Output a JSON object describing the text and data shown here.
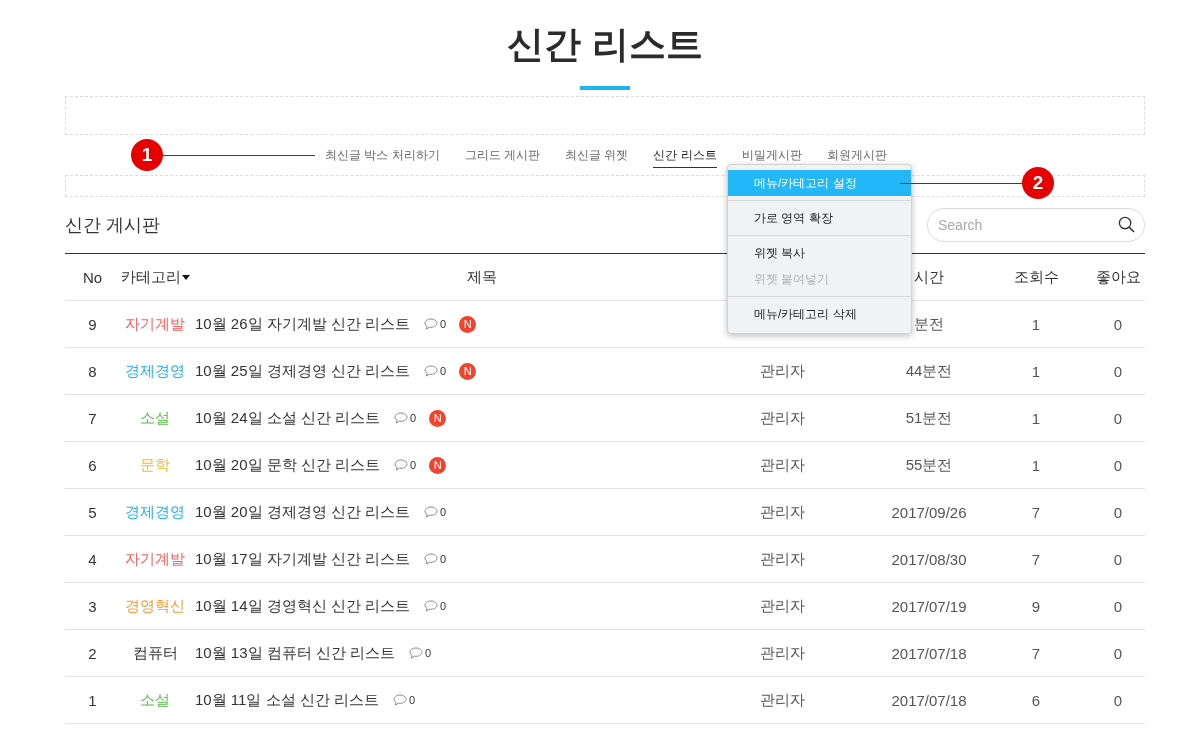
{
  "page_title": "신간 리스트",
  "nav": {
    "items": [
      {
        "label": "최신글 박스 처리하기",
        "selected": false
      },
      {
        "label": "그리드 게시판",
        "selected": false
      },
      {
        "label": "최신글 위젯",
        "selected": false
      },
      {
        "label": "신간 리스트",
        "selected": true
      },
      {
        "label": "비밀게시판",
        "selected": false
      },
      {
        "label": "회원게시판",
        "selected": false
      }
    ]
  },
  "callouts": [
    {
      "label": "1"
    },
    {
      "label": "2"
    }
  ],
  "context_menu": {
    "groups": [
      [
        {
          "label": "메뉴/카테고리 설정",
          "selected": true,
          "disabled": false
        }
      ],
      [
        {
          "label": "가로 영역 확장",
          "selected": false,
          "disabled": false
        }
      ],
      [
        {
          "label": "위젯 복사",
          "selected": false,
          "disabled": false
        },
        {
          "label": "위젯 붙여넣기",
          "selected": false,
          "disabled": true
        }
      ],
      [
        {
          "label": "메뉴/카테고리 삭제",
          "selected": false,
          "disabled": false
        }
      ]
    ]
  },
  "board": {
    "title": "신간 게시판",
    "search": {
      "placeholder": "Search"
    }
  },
  "table": {
    "header": {
      "no": "No",
      "category": "카테고리",
      "title": "제목",
      "time": "시간",
      "views": "조회수",
      "likes": "좋아요"
    },
    "rows": [
      {
        "no": "9",
        "category": {
          "label": "자기계발",
          "color": "#ff5c5c"
        },
        "title": "10월 26일 자기계발 신간 리스트",
        "comments": "0",
        "badge": "N",
        "time": "분전",
        "views": "1",
        "likes": "0"
      },
      {
        "no": "8",
        "category": {
          "label": "경제경영",
          "color": "#1fb2f0"
        },
        "title": "10월 25일 경제경영 신간 리스트",
        "comments": "0",
        "badge": "N",
        "writer": "관리자",
        "time": "44분전",
        "views": "1",
        "likes": "0"
      },
      {
        "no": "7",
        "category": {
          "label": "소설",
          "color": "#5cbf4a"
        },
        "title": "10월 24일 소설 신간 리스트",
        "comments": "0",
        "badge": "N",
        "writer": "관리자",
        "time": "51분전",
        "views": "1",
        "likes": "0"
      },
      {
        "no": "6",
        "category": {
          "label": "문학",
          "color": "#f2b736"
        },
        "title": "10월 20일 문학 신간 리스트",
        "comments": "0",
        "badge": "N",
        "writer": "관리자",
        "time": "55분전",
        "views": "1",
        "likes": "0"
      },
      {
        "no": "5",
        "category": {
          "label": "경제경영",
          "color": "#1fb2f0"
        },
        "title": "10월 20일 경제경영 신간 리스트",
        "comments": "0",
        "writer": "관리자",
        "time": "2017/09/26",
        "views": "7",
        "likes": "0"
      },
      {
        "no": "4",
        "category": {
          "label": "자기계발",
          "color": "#ff5c5c"
        },
        "title": "10월 17일 자기계발 신간 리스트",
        "comments": "0",
        "writer": "관리자",
        "time": "2017/08/30",
        "views": "7",
        "likes": "0"
      },
      {
        "no": "3",
        "category": {
          "label": "경영혁신",
          "color": "#f39a3b"
        },
        "title": "10월 14일 경영혁신 신간 리스트",
        "comments": "0",
        "writer": "관리자",
        "time": "2017/07/19",
        "views": "9",
        "likes": "0"
      },
      {
        "no": "2",
        "category": {
          "label": "컴퓨터",
          "color": "#333333"
        },
        "title": "10월 13일 컴퓨터 신간 리스트",
        "comments": "0",
        "writer": "관리자",
        "time": "2017/07/18",
        "views": "7",
        "likes": "0"
      },
      {
        "no": "1",
        "category": {
          "label": "소설",
          "color": "#5cbf4a"
        },
        "title": "10월 11일 소설 신간 리스트",
        "comments": "0",
        "writer": "관리자",
        "time": "2017/07/18",
        "views": "6",
        "likes": "0"
      }
    ]
  }
}
